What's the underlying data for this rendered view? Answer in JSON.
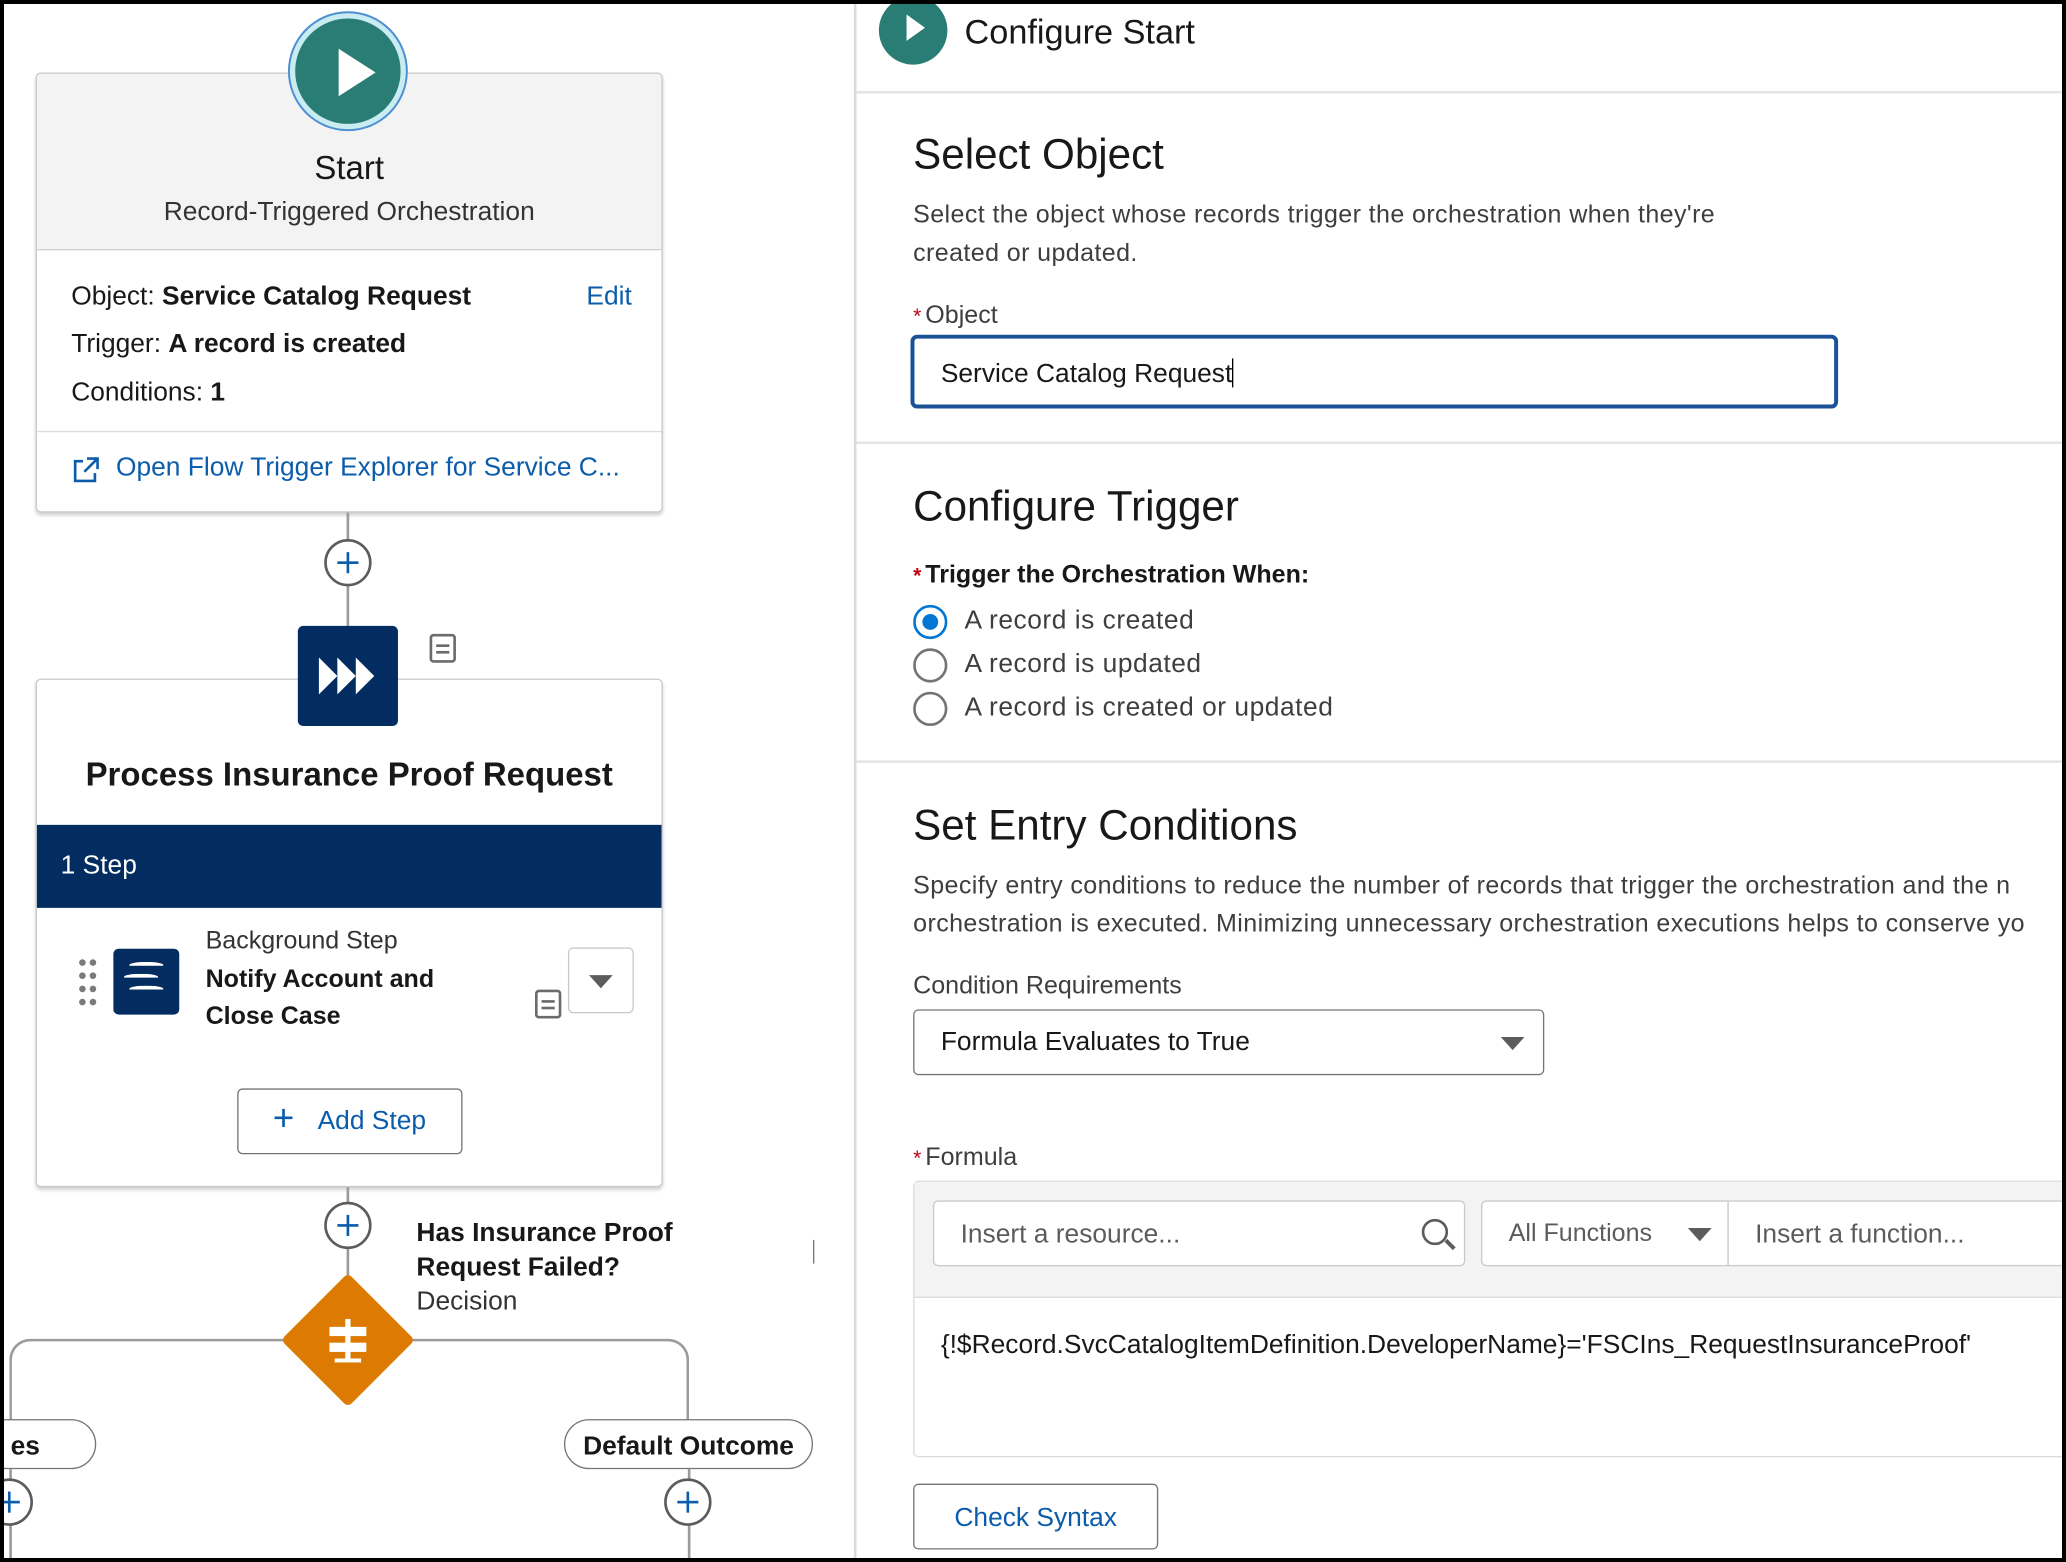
{
  "canvas": {
    "start": {
      "title": "Start",
      "subtitle": "Record-Triggered Orchestration",
      "object_label": "Object:",
      "object_value": "Service Catalog Request",
      "edit_link": "Edit",
      "trigger_label": "Trigger:",
      "trigger_value": "A record is created",
      "conditions_label": "Conditions:",
      "conditions_value": "1",
      "explorer_link": "Open Flow Trigger Explorer for Service C..."
    },
    "stage": {
      "title": "Process Insurance Proof Request",
      "step_count": "1 Step",
      "step_type": "Background Step",
      "step_name_line1": "Notify Account and",
      "step_name_line2": "Close Case",
      "add_step": "Add Step"
    },
    "decision": {
      "name_line1": "Has Insurance Proof",
      "name_line2": "Request Failed?",
      "type": "Decision",
      "left_outcome": "es",
      "default_outcome": "Default Outcome"
    }
  },
  "panel": {
    "title": "Configure Start",
    "select_object": {
      "heading": "Select Object",
      "help_line1": "Select the object whose records trigger the orchestration when they're",
      "help_line2": "created or updated.",
      "object_label": "Object",
      "object_value": "Service Catalog Request"
    },
    "configure_trigger": {
      "heading": "Configure Trigger",
      "label": "Trigger the Orchestration When:",
      "options": [
        "A record is created",
        "A record is updated",
        "A record is created or updated"
      ],
      "selected": "A record is created"
    },
    "entry_conditions": {
      "heading": "Set Entry Conditions",
      "help_line1": "Specify entry conditions to reduce the number of records that trigger the orchestration and the n",
      "help_line2": "orchestration is executed. Minimizing unnecessary orchestration executions helps to conserve yo",
      "requirements_label": "Condition Requirements",
      "requirements_value": "Formula Evaluates to True",
      "formula_label": "Formula",
      "resource_placeholder": "Insert a resource...",
      "functions_value": "All Functions",
      "function_placeholder": "Insert a function...",
      "formula_value": "{!$Record.SvcCatalogItemDefinition.DeveloperName}='FSCIns_RequestInsuranceProof'",
      "check_syntax": "Check Syntax"
    }
  },
  "colors": {
    "start_green": "#2a7d74",
    "navy": "#032d60",
    "decision_orange": "#dd7a01",
    "link_blue": "#0b5cab",
    "focus_blue": "#1b5297",
    "required_red": "#ba0517"
  }
}
